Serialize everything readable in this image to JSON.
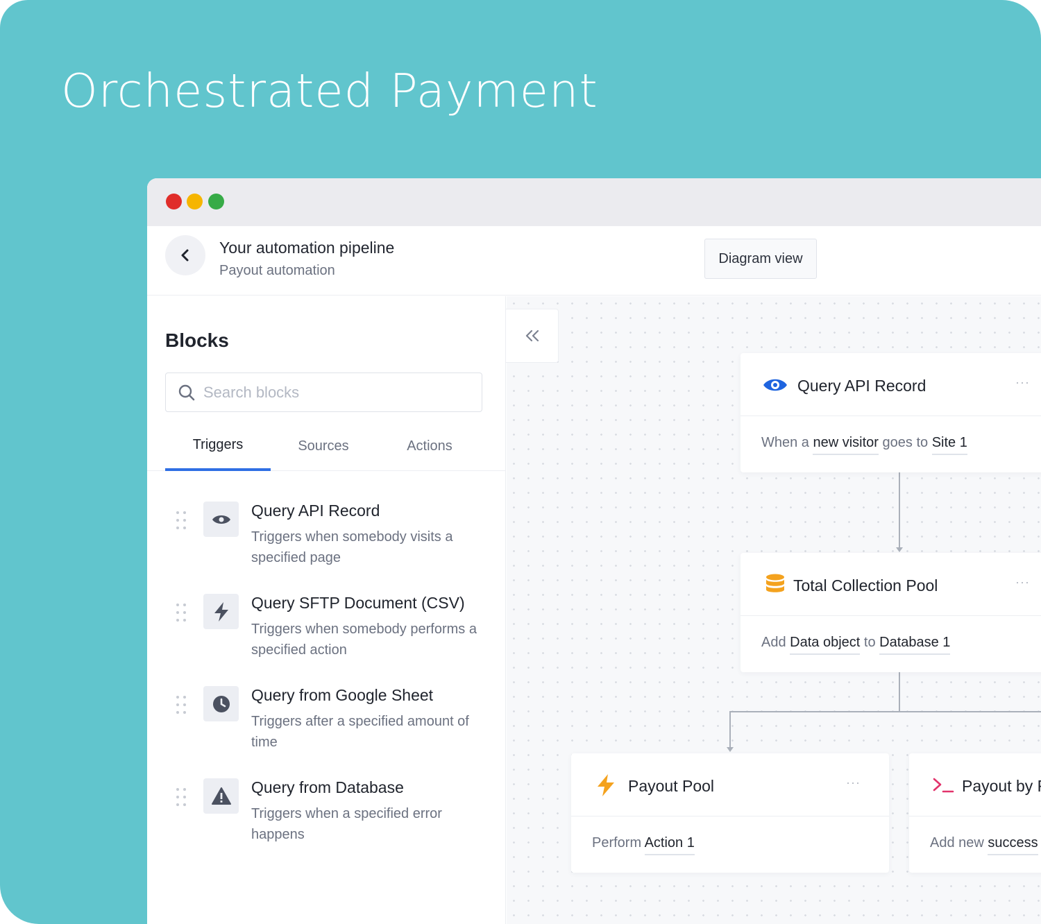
{
  "hero": {
    "title": "Orchestrated Payment"
  },
  "colors": {
    "background": "#61c5cd",
    "accent": "#2f6fe4",
    "eye": "#1e64df",
    "database": "#f4a21e",
    "bolt": "#f4a21e",
    "terminal": "#e2336b"
  },
  "header": {
    "title": "Your automation pipeline",
    "subtitle": "Payout automation",
    "diagram_button": "Diagram view"
  },
  "sidebar": {
    "title": "Blocks",
    "search_placeholder": "Search blocks",
    "tabs": [
      {
        "label": "Triggers",
        "active": true
      },
      {
        "label": "Sources",
        "active": false
      },
      {
        "label": "Actions",
        "active": false
      }
    ],
    "items": [
      {
        "icon": "eye-icon",
        "title": "Query API Record",
        "description": "Triggers when somebody visits a specified page"
      },
      {
        "icon": "bolt-icon",
        "title": "Query SFTP Document (CSV)",
        "description": "Triggers when somebody performs a specified action"
      },
      {
        "icon": "clock-icon",
        "title": "Query from Google Sheet",
        "description": "Triggers after a specified amount of time"
      },
      {
        "icon": "warning-icon",
        "title": "Query from Database",
        "description": "Triggers when a specified error happens"
      }
    ]
  },
  "canvas": {
    "cards": [
      {
        "icon": "eye-icon",
        "title": "Query API Record",
        "more": "···",
        "body": [
          "When a ",
          "new visitor",
          " goes to ",
          "Site 1"
        ]
      },
      {
        "icon": "database-icon",
        "title": "Total Collection Pool",
        "more": "···",
        "body": [
          "Add ",
          "Data object",
          " to ",
          "Database 1"
        ]
      },
      {
        "icon": "bolt-icon",
        "title": "Payout Pool",
        "more": "···",
        "body": [
          "Perform ",
          "Action 1"
        ]
      },
      {
        "icon": "terminal-icon",
        "title": "Payout by F",
        "body": [
          "Add new ",
          "success"
        ]
      }
    ]
  }
}
